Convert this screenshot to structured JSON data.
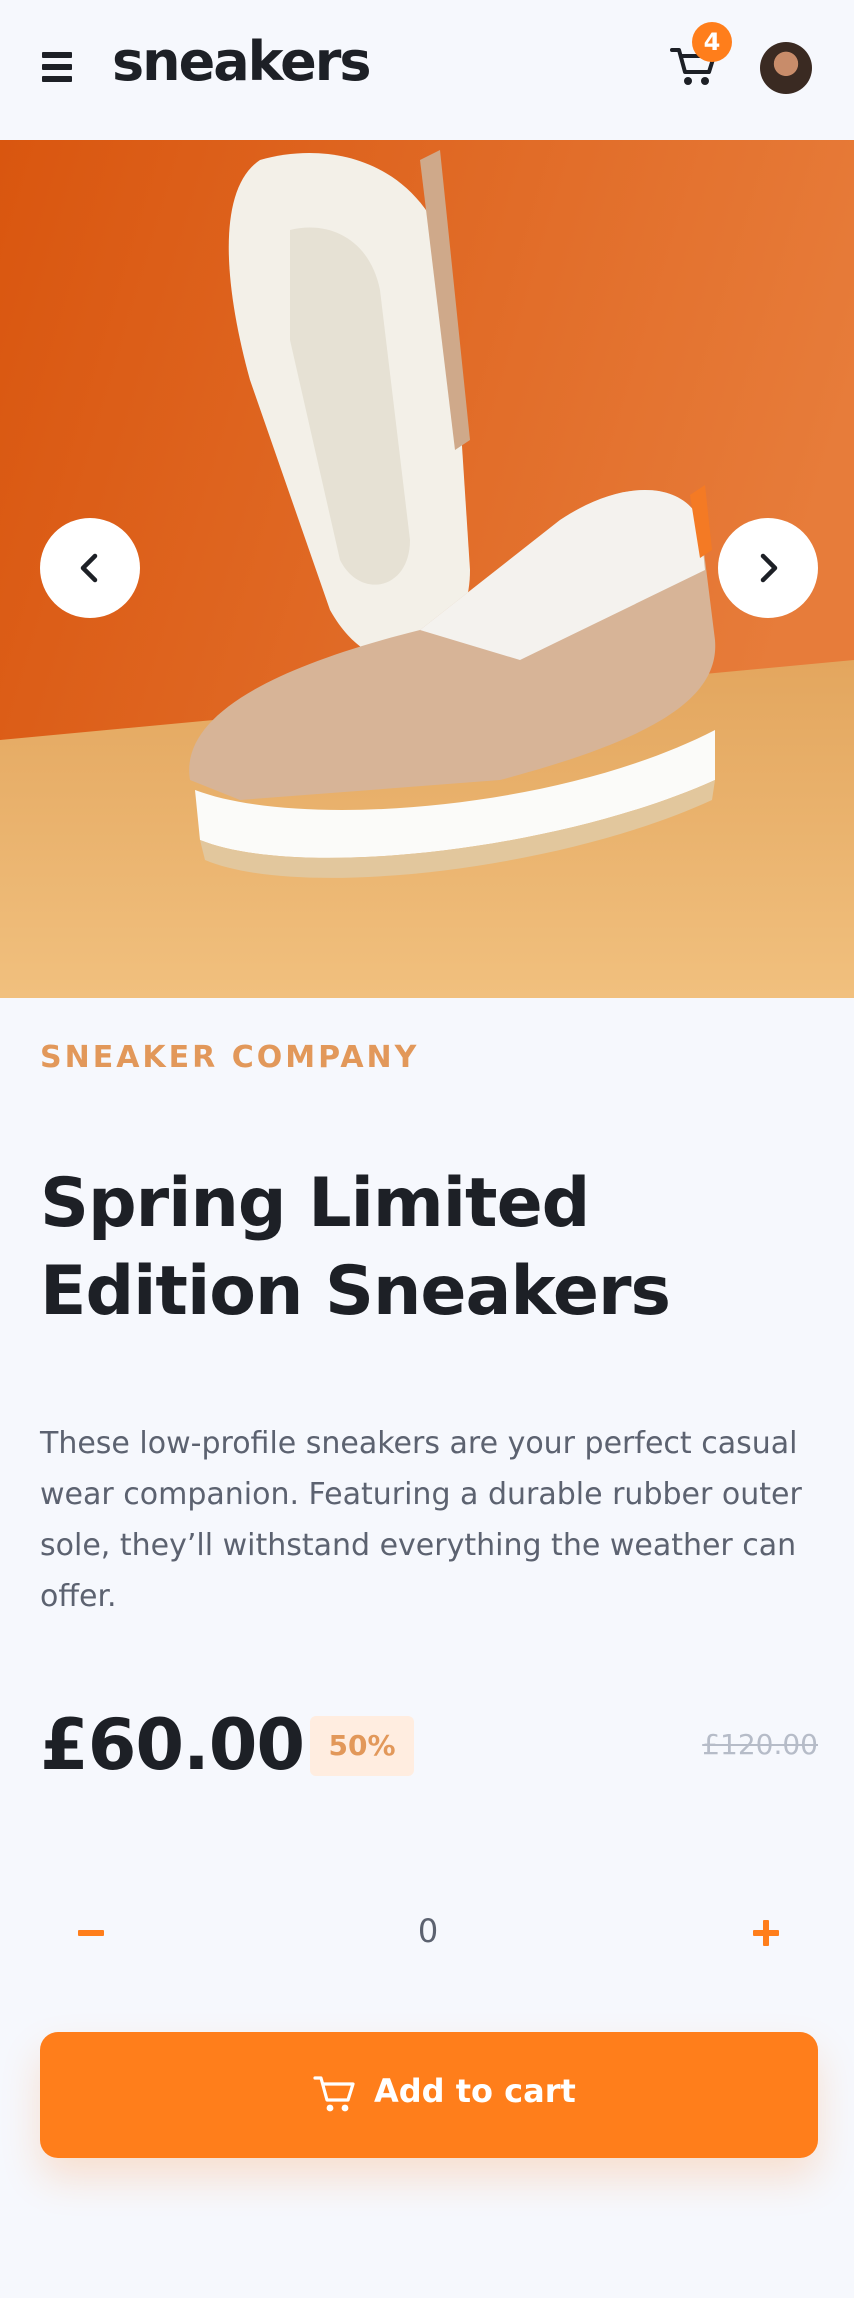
{
  "header": {
    "logo": "sneakers",
    "cart_count": "4"
  },
  "product": {
    "company": "SNEAKER COMPANY",
    "title": "Spring Limited Edition Sneakers",
    "description": "These low-profile sneakers are your perfect casual wear companion. Featuring a durable rubber outer sole, they’ll withstand everything the weather can offer.",
    "price": "£60.00",
    "discount": "50%",
    "original_price": "£120.00"
  },
  "quantity": {
    "value": "0"
  },
  "cta": {
    "label": "Add to cart",
    "icon": "cart-icon"
  },
  "colors": {
    "accent": "#ff7e1b",
    "accent_pale": "#ffede0",
    "brand_text": "#e2985a",
    "dark": "#1d2026",
    "muted": "#5c6270",
    "background": "#f6f8fd"
  },
  "icons": [
    "menu-icon",
    "cart-icon",
    "avatar",
    "chevron-left-icon",
    "chevron-right-icon",
    "minus-icon",
    "plus-icon"
  ]
}
